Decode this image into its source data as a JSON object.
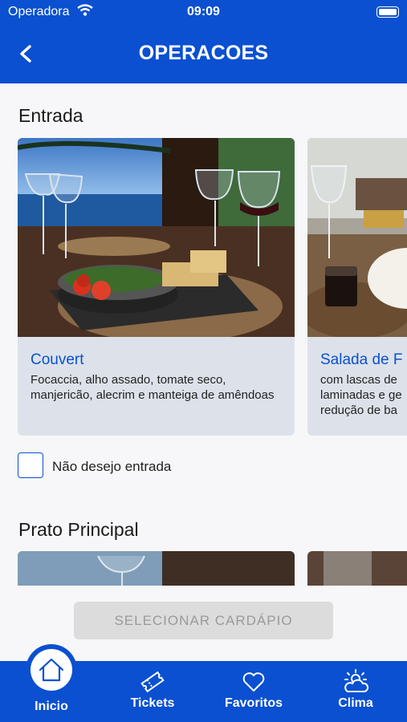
{
  "status": {
    "carrier": "Operadora",
    "time": "09:09"
  },
  "header": {
    "title": "OPERACOES"
  },
  "sections": [
    {
      "title": "Entrada"
    },
    {
      "title": "Prato Principal"
    }
  ],
  "entrada_items": [
    {
      "name": "Couvert",
      "description": "Focaccia, alho assado, tomate seco, manjericão, alecrim e manteiga de amêndoas"
    },
    {
      "name": "Salada de F",
      "description": "com lascas de laminadas e ge redução de ba"
    }
  ],
  "no_entrada": {
    "label": "Não desejo entrada"
  },
  "select_button": {
    "label": "SELECIONAR CARDÁPIO"
  },
  "tabs": [
    {
      "label": "Inicio",
      "icon": "home-icon"
    },
    {
      "label": "Tickets",
      "icon": "ticket-icon"
    },
    {
      "label": "Favoritos",
      "icon": "heart-icon"
    },
    {
      "label": "Clima",
      "icon": "weather-icon"
    }
  ],
  "colors": {
    "primary": "#0a50d0",
    "card": "#dde2ea",
    "background": "#f7f7f9"
  }
}
